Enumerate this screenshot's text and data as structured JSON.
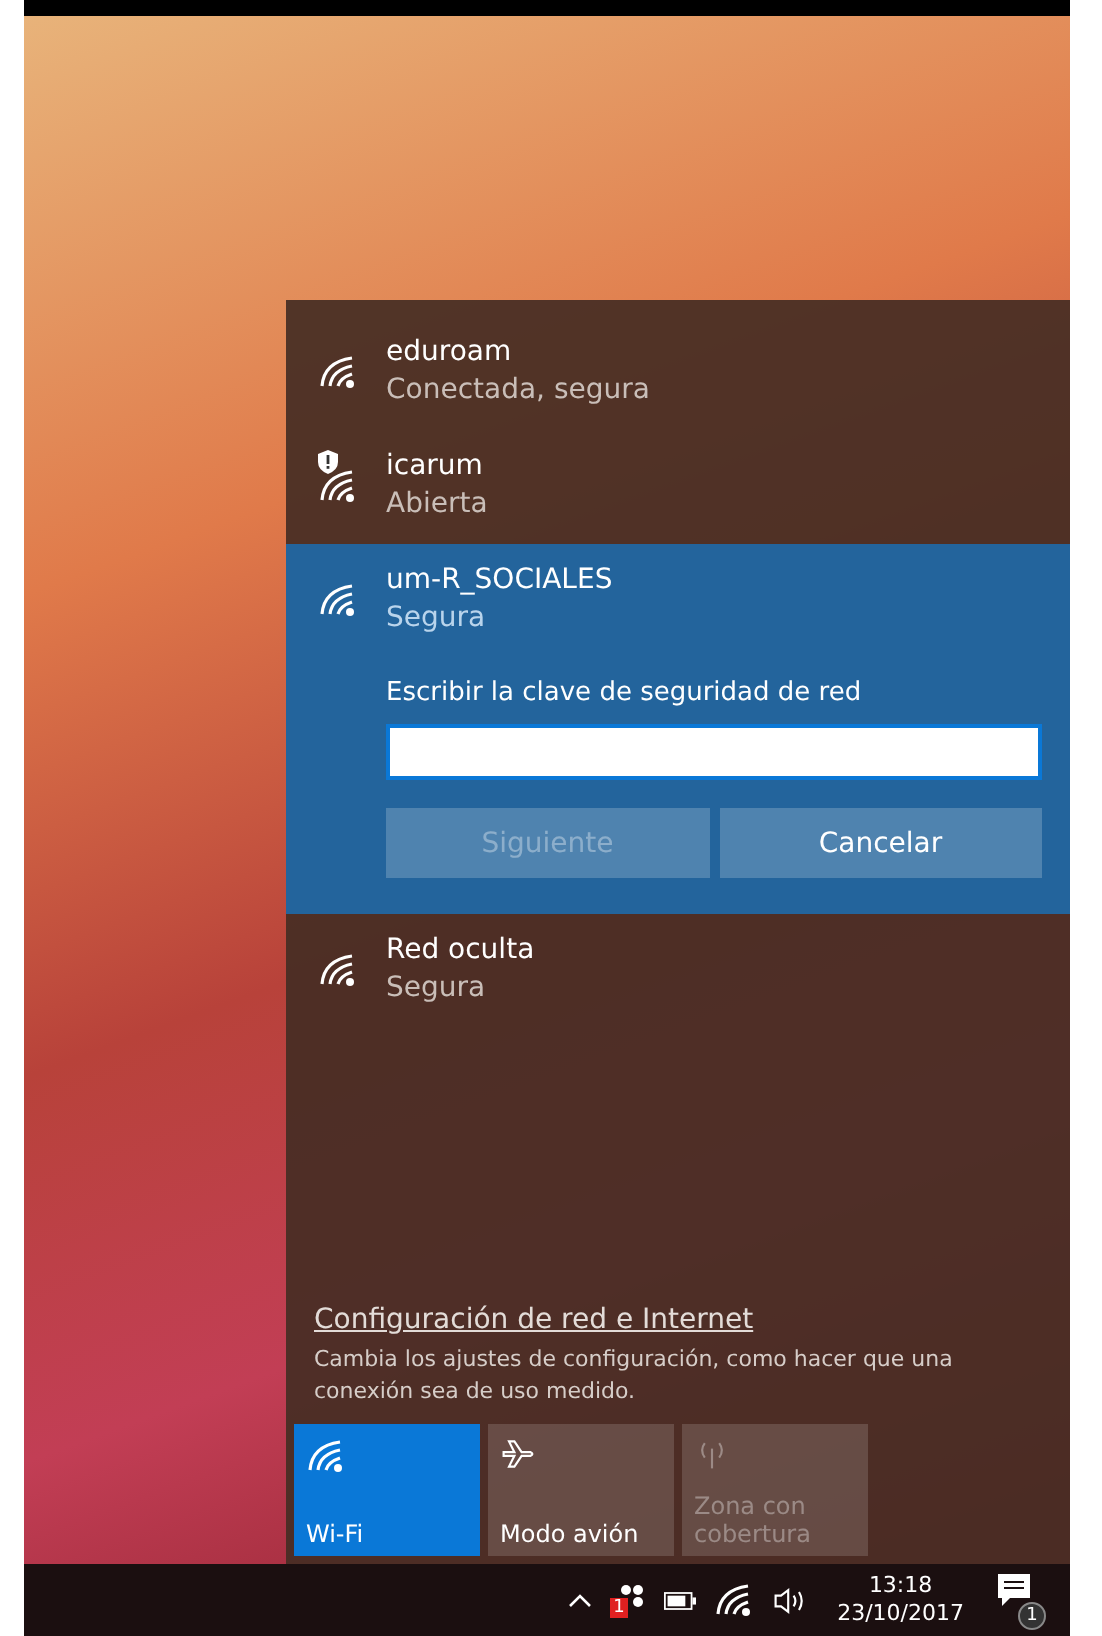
{
  "networks": [
    {
      "name": "eduroam",
      "status": "Conectada, segura",
      "warning": false,
      "selected": false
    },
    {
      "name": "icarum",
      "status": "Abierta",
      "warning": true,
      "selected": false
    },
    {
      "name": "um-R_SOCIALES",
      "status": "Segura",
      "warning": false,
      "selected": true,
      "prompt": "Escribir la clave de seguridad de red",
      "buttons": [
        {
          "label": "Siguiente",
          "disabled": true
        },
        {
          "label": "Cancelar",
          "disabled": false
        }
      ]
    },
    {
      "name": "Red oculta",
      "status": "Segura",
      "warning": false,
      "selected": false
    }
  ],
  "settings": {
    "link": "Configuración de red e Internet",
    "description": "Cambia los ajustes de configuración, como hacer que una conexión sea de uso medido."
  },
  "tiles": [
    {
      "kind": "wifi",
      "label": "Wi-Fi",
      "on": true,
      "disabled": false
    },
    {
      "kind": "airplane",
      "label": "Modo avión",
      "on": false,
      "disabled": false
    },
    {
      "kind": "hotspot",
      "label": "Zona con cobertura",
      "on": false,
      "disabled": true
    }
  ],
  "taskbar": {
    "app_badge": "1",
    "time": "13:18",
    "date": "23/10/2017",
    "notification_count": "1"
  }
}
